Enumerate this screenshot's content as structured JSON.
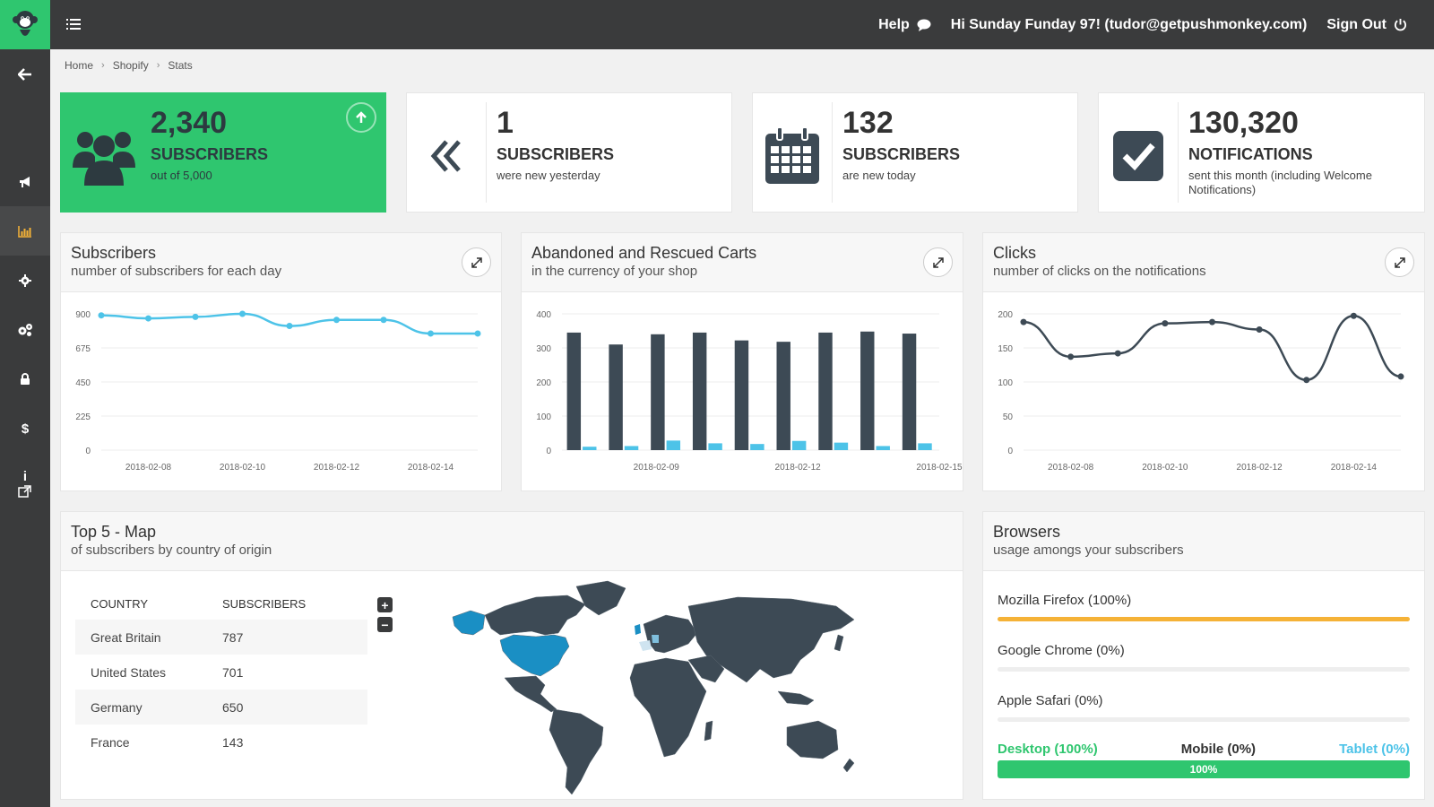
{
  "header": {
    "help_label": "Help",
    "user_greeting": "Hi Sunday Funday 97! (tudor@getpushmonkey.com)",
    "signout_label": "Sign Out"
  },
  "sidebar": {
    "items": [
      {
        "icon": "back-arrow-icon",
        "active": false
      },
      {
        "icon": "megaphone-icon",
        "active": false
      },
      {
        "icon": "bar-chart-icon",
        "active": true
      },
      {
        "icon": "gear-icon",
        "active": false
      },
      {
        "icon": "gears-icon",
        "active": false
      },
      {
        "icon": "lock-icon",
        "active": false
      },
      {
        "icon": "dollar-icon",
        "active": false
      },
      {
        "icon": "info-icon",
        "active": false
      }
    ]
  },
  "breadcrumb": [
    "Home",
    "Shopify",
    "Stats"
  ],
  "stats": [
    {
      "value": "2,340",
      "label": "SUBSCRIBERS",
      "sub": "out of 5,000",
      "icon": "users-icon"
    },
    {
      "value": "1",
      "label": "SUBSCRIBERS",
      "sub": "were new yesterday",
      "icon": "double-chevron-left-icon"
    },
    {
      "value": "132",
      "label": "SUBSCRIBERS",
      "sub": "are new today",
      "icon": "calendar-icon"
    },
    {
      "value": "130,320",
      "label": "NOTIFICATIONS",
      "sub": "sent this month (including Welcome Notifications)",
      "icon": "checkbox-icon"
    }
  ],
  "panels": {
    "subscribers": {
      "title": "Subscribers",
      "subtitle": "number of subscribers for each day"
    },
    "carts": {
      "title": "Abandoned and Rescued Carts",
      "subtitle": "in the currency of your shop"
    },
    "clicks": {
      "title": "Clicks",
      "subtitle": "number of clicks on the notifications"
    },
    "map": {
      "title": "Top 5 - Map",
      "subtitle": "of subscribers by country of origin"
    },
    "browsers": {
      "title": "Browsers",
      "subtitle": "usage amongs your subscribers"
    }
  },
  "chart_data": [
    {
      "type": "line",
      "x": [
        "2018-02-07",
        "2018-02-08",
        "2018-02-09",
        "2018-02-10",
        "2018-02-11",
        "2018-02-12",
        "2018-02-13",
        "2018-02-14",
        "2018-02-15"
      ],
      "series": [
        {
          "values": [
            890,
            870,
            880,
            900,
            820,
            860,
            860,
            770,
            770
          ],
          "color": "#4dc3e8"
        }
      ],
      "yticks": [
        "900",
        "675",
        "450",
        "225",
        "0"
      ],
      "xticks": [
        "2018-02-08",
        "2018-02-10",
        "2018-02-12",
        "2018-02-14"
      ],
      "ylim": [
        0,
        900
      ],
      "grid": true
    },
    {
      "type": "bar",
      "categories": [
        "2018-02-07",
        "2018-02-08",
        "2018-02-09",
        "2018-02-10",
        "2018-02-11",
        "2018-02-12",
        "2018-02-13",
        "2018-02-14",
        "2018-02-15"
      ],
      "series": [
        {
          "values": [
            345,
            310,
            340,
            345,
            322,
            318,
            345,
            348,
            342
          ],
          "color": "#3d4a55"
        },
        {
          "values": [
            10,
            12,
            28,
            20,
            18,
            27,
            22,
            12,
            20
          ],
          "color": "#4dc3e8"
        }
      ],
      "yticks": [
        "400",
        "300",
        "200",
        "100",
        "0"
      ],
      "xticks": [
        "2018-02-09",
        "2018-02-12",
        "2018-02-15"
      ],
      "ylim": [
        0,
        400
      ],
      "grid": true
    },
    {
      "type": "line",
      "x": [
        "2018-02-07",
        "2018-02-08",
        "2018-02-09",
        "2018-02-10",
        "2018-02-11",
        "2018-02-12",
        "2018-02-13",
        "2018-02-14",
        "2018-02-15"
      ],
      "series": [
        {
          "values": [
            188,
            137,
            142,
            186,
            188,
            177,
            103,
            197,
            108
          ],
          "color": "#3d4a55"
        }
      ],
      "yticks": [
        "200",
        "150",
        "100",
        "50",
        "0"
      ],
      "xticks": [
        "2018-02-08",
        "2018-02-10",
        "2018-02-12",
        "2018-02-14"
      ],
      "ylim": [
        0,
        200
      ],
      "grid": true
    }
  ],
  "countries": {
    "headers": [
      "COUNTRY",
      "SUBSCRIBERS"
    ],
    "rows": [
      [
        "Great Britain",
        "787"
      ],
      [
        "United States",
        "701"
      ],
      [
        "Germany",
        "650"
      ],
      [
        "France",
        "143"
      ]
    ]
  },
  "browsers": [
    {
      "label": "Mozilla Firefox (100%)",
      "fraction": 1.0
    },
    {
      "label": "Google Chrome (0%)",
      "fraction": 0
    },
    {
      "label": "Apple Safari (0%)",
      "fraction": 0
    }
  ],
  "devices": {
    "desktop_label": "Desktop (100%)",
    "mobile_label": "Mobile (0%)",
    "tablet_label": "Tablet (0%)",
    "bar_label": "100%",
    "desktop_fraction": 1.0
  },
  "colors": {
    "accent_green": "#2fc66f",
    "dark": "#3a3b3c",
    "chart_blue": "#4dc3e8",
    "chart_dark": "#3d4a55",
    "firefox_orange": "#f5b237",
    "tablet_blue": "#4dc3e8",
    "map_highlight": "#1a8fc4",
    "map_land": "#3d4a55"
  }
}
